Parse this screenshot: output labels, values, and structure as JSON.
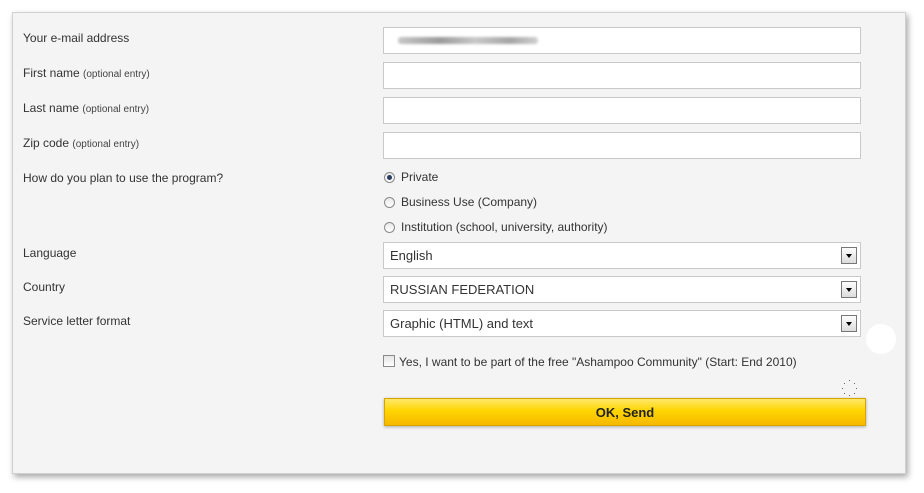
{
  "form": {
    "email": {
      "label": "Your e-mail address",
      "value": ""
    },
    "first_name": {
      "label": "First name",
      "optional": "(optional entry)",
      "value": ""
    },
    "last_name": {
      "label": "Last name",
      "optional": "(optional entry)",
      "value": ""
    },
    "zip": {
      "label": "Zip code",
      "optional": "(optional entry)",
      "value": ""
    },
    "usage": {
      "label": "How do you plan to use the program?",
      "options": [
        {
          "label": "Private",
          "checked": true
        },
        {
          "label": "Business Use (Company)",
          "checked": false
        },
        {
          "label": "Institution (school, university, authority)",
          "checked": false
        }
      ]
    },
    "language": {
      "label": "Language",
      "value": "English"
    },
    "country": {
      "label": "Country",
      "value": "RUSSIAN FEDERATION"
    },
    "letter_format": {
      "label": "Service letter format",
      "value": "Graphic (HTML) and text"
    },
    "community": {
      "label": "Yes, I want to be part of the free \"Ashampoo Community\" (Start: End 2010)",
      "checked": false
    },
    "submit_label": "OK, Send"
  },
  "colors": {
    "button_yellow": "#ffd500",
    "panel_bg": "#f4f4f4"
  }
}
